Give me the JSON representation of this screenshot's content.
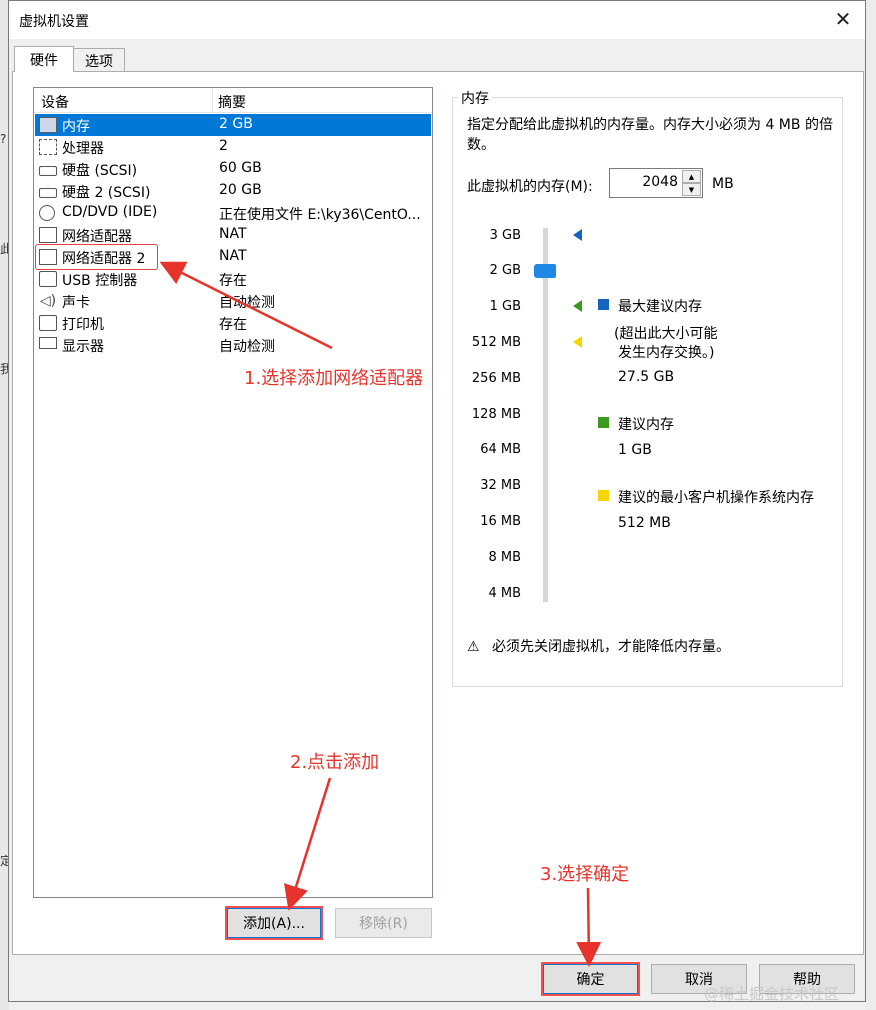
{
  "window": {
    "title": "虚拟机设置",
    "close_glyph": "✕"
  },
  "tabs": [
    {
      "label": "硬件"
    },
    {
      "label": "选项"
    }
  ],
  "device_list": {
    "headers": {
      "device": "设备",
      "summary": "摘要"
    },
    "rows": [
      {
        "name": "内存",
        "summary": "2 GB",
        "icon": "memory-icon"
      },
      {
        "name": "处理器",
        "summary": "2",
        "icon": "processor-icon"
      },
      {
        "name": "硬盘 (SCSI)",
        "summary": "60 GB",
        "icon": "hard-disk-icon"
      },
      {
        "name": "硬盘 2 (SCSI)",
        "summary": "20 GB",
        "icon": "hard-disk-icon"
      },
      {
        "name": "CD/DVD (IDE)",
        "summary": "正在使用文件 E:\\ky36\\CentO...",
        "icon": "cd-dvd-icon"
      },
      {
        "name": "网络适配器",
        "summary": "NAT",
        "icon": "network-adapter-icon"
      },
      {
        "name": "网络适配器 2",
        "summary": "NAT",
        "icon": "network-adapter-icon"
      },
      {
        "name": "USB 控制器",
        "summary": "存在",
        "icon": "usb-icon"
      },
      {
        "name": "声卡",
        "summary": "自动检测",
        "icon": "sound-card-icon"
      },
      {
        "name": "打印机",
        "summary": "存在",
        "icon": "printer-icon"
      },
      {
        "name": "显示器",
        "summary": "自动检测",
        "icon": "display-icon"
      }
    ]
  },
  "buttons": {
    "add": "添加(A)...",
    "remove": "移除(R)",
    "ok": "确定",
    "cancel": "取消",
    "help": "帮助"
  },
  "memory": {
    "group_title": "内存",
    "description": "指定分配给此虚拟机的内存量。内存大小必须为 4 MB 的倍数。",
    "field_label": "此虚拟机的内存(M):",
    "value": "2048",
    "unit": "MB",
    "ticks": [
      "3 GB",
      "2 GB",
      "1 GB",
      "512 MB",
      "256 MB",
      "128 MB",
      "64 MB",
      "32 MB",
      "16 MB",
      "8 MB",
      "4 MB"
    ],
    "legend": {
      "max_label": "最大建议内存",
      "max_note_1": "(超出此大小可能",
      "max_note_2": "发生内存交换。)",
      "max_value": "27.5 GB",
      "recommended_label": "建议内存",
      "recommended_value": "1 GB",
      "min_label": "建议的最小客户机操作系统内存",
      "min_value": "512 MB"
    },
    "warning": "必须先关闭虚拟机，才能降低内存量。"
  },
  "annotations": {
    "step1": "1.选择添加网络适配器",
    "step2": "2.点击添加",
    "step3": "3.选择确定"
  },
  "watermark": "@稀土掘金技术社区",
  "background_glyphs": [
    "此",
    "?",
    "我",
    "定"
  ],
  "colors": {
    "selection": "#0078d7",
    "annotation": "#e8332c",
    "max_marker": "#1565c0",
    "recommended_marker": "#3c9a1f",
    "min_marker": "#f5d600"
  }
}
